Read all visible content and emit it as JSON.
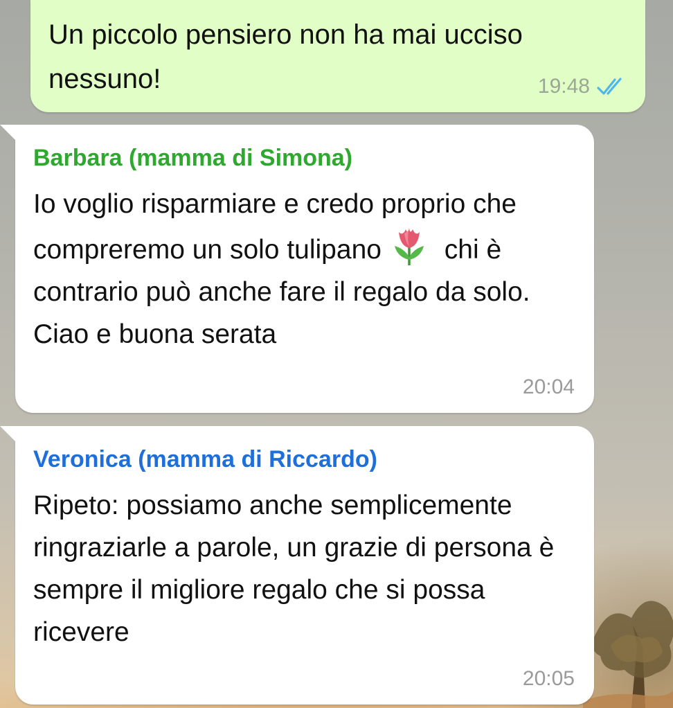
{
  "chat": {
    "messages": [
      {
        "direction": "outgoing",
        "text": "Un piccolo pensiero non ha mai ucciso nessuno!",
        "time": "19:48",
        "status_icon": "double-check-read-icon"
      },
      {
        "direction": "incoming",
        "sender": "Barbara (mamma di Simona)",
        "sender_color": "#2fa82f",
        "text_part1": "Io voglio risparmiare e credo proprio che compreremo un solo tulipano",
        "emoji_icon": "tulip-emoji-icon",
        "text_part2": "chi è contrario può anche fare il regalo da solo. Ciao e buona serata",
        "time": "20:04"
      },
      {
        "direction": "incoming",
        "sender": "Veronica (mamma di Riccardo)",
        "sender_color": "#1e6fd9",
        "text": "Ripeto: possiamo anche semplicemente ringraziarle a parole, un grazie di persona è sempre il migliore regalo che si possa ricevere",
        "time": "20:05"
      }
    ]
  },
  "colors": {
    "outgoing_bubble": "#e1fec6",
    "incoming_bubble": "#ffffff",
    "read_ticks": "#4fb6ec",
    "timestamp": "#9a9a9a"
  }
}
